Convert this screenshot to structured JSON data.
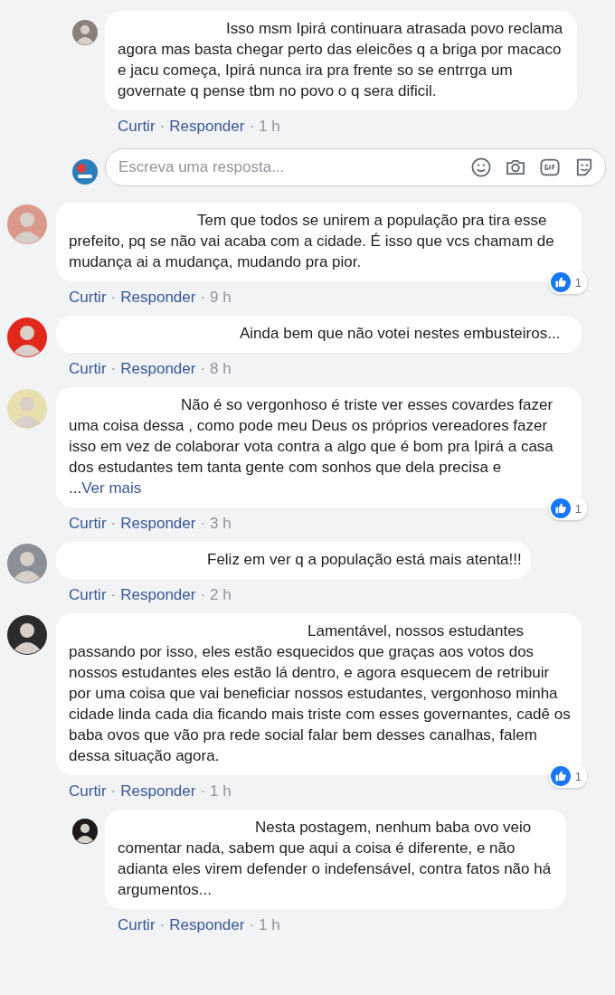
{
  "thread": [
    {
      "kind": "reply",
      "avatar": {
        "color": "#8a7f78"
      },
      "text": "Isso msm Ipirá continuara atrasada povo reclama agora mas basta chegar perto das eleicões q a briga por macaco e jacu começa, Ipirá nunca ira pra frente so se entrrga um governate q pense tbm no povo o q sera dificil.",
      "like": "Curtir",
      "dot1": "·",
      "respond": "Responder",
      "dot2": "·",
      "time": "1 h"
    },
    {
      "kind": "composer",
      "avatar": {
        "color": "#2a7fb8"
      },
      "placeholder": "Escreva uma resposta..."
    },
    {
      "kind": "comment",
      "avatar": {
        "color": "#d99a8c"
      },
      "text": "Tem que todos se unirem a população pra tira esse prefeito, pq se não vai acaba com a cidade. É isso que vcs chamam de mudança ai a mudança, mudando pra pior.",
      "likes": "1",
      "like": "Curtir",
      "dot1": "·",
      "respond": "Responder",
      "dot2": "·",
      "time": "9 h"
    },
    {
      "kind": "comment",
      "avatar": {
        "color": "#e0281c"
      },
      "text": "Ainda bem que não votei nestes embusteiros...",
      "like": "Curtir",
      "dot1": "·",
      "respond": "Responder",
      "dot2": "·",
      "time": "8 h"
    },
    {
      "kind": "comment",
      "avatar": {
        "color": "#e8dfae"
      },
      "text": "Não é so vergonhoso é triste ver esses covardes fazer uma coisa dessa , como pode meu Deus os próprios vereadores fazer isso em vez de colaborar vota contra a algo que é bom pra Ipirá a casa dos estudantes tem tanta gente com sonhos que dela precisa e ...",
      "more": "Ver mais",
      "likes": "1",
      "like": "Curtir",
      "dot1": "·",
      "respond": "Responder",
      "dot2": "·",
      "time": "3 h"
    },
    {
      "kind": "comment",
      "avatar": {
        "color": "#8b8f96"
      },
      "text": "Feliz em ver q a população está mais atenta!!!",
      "like": "Curtir",
      "dot1": "·",
      "respond": "Responder",
      "dot2": "·",
      "time": "2 h"
    },
    {
      "kind": "comment",
      "avatar": {
        "color": "#2b2b2b"
      },
      "text": "Lamentável, nossos estudantes passando por isso, eles estão esquecidos que graças aos votos dos nossos estudantes eles estão lá dentro, e agora esquecem de retribuir por uma coisa que vai beneficiar nossos estudantes, vergonhoso minha cidade linda cada dia ficando mais triste com esses governantes, cadê os baba ovos que vão pra rede social falar bem desses canalhas, falem dessa situação agora.",
      "likes": "1",
      "like": "Curtir",
      "dot1": "·",
      "respond": "Responder",
      "dot2": "·",
      "time": "1 h"
    },
    {
      "kind": "reply",
      "avatar": {
        "color": "#1e1a1a"
      },
      "text": "Nesta postagem, nenhum baba ovo veio comentar nada, sabem que aqui a coisa é diferente, e não adianta eles virem defender o indefensável, contra fatos não há argumentos...",
      "like": "Curtir",
      "dot1": "·",
      "respond": "Responder",
      "dot2": "·",
      "time": "1 h"
    }
  ]
}
